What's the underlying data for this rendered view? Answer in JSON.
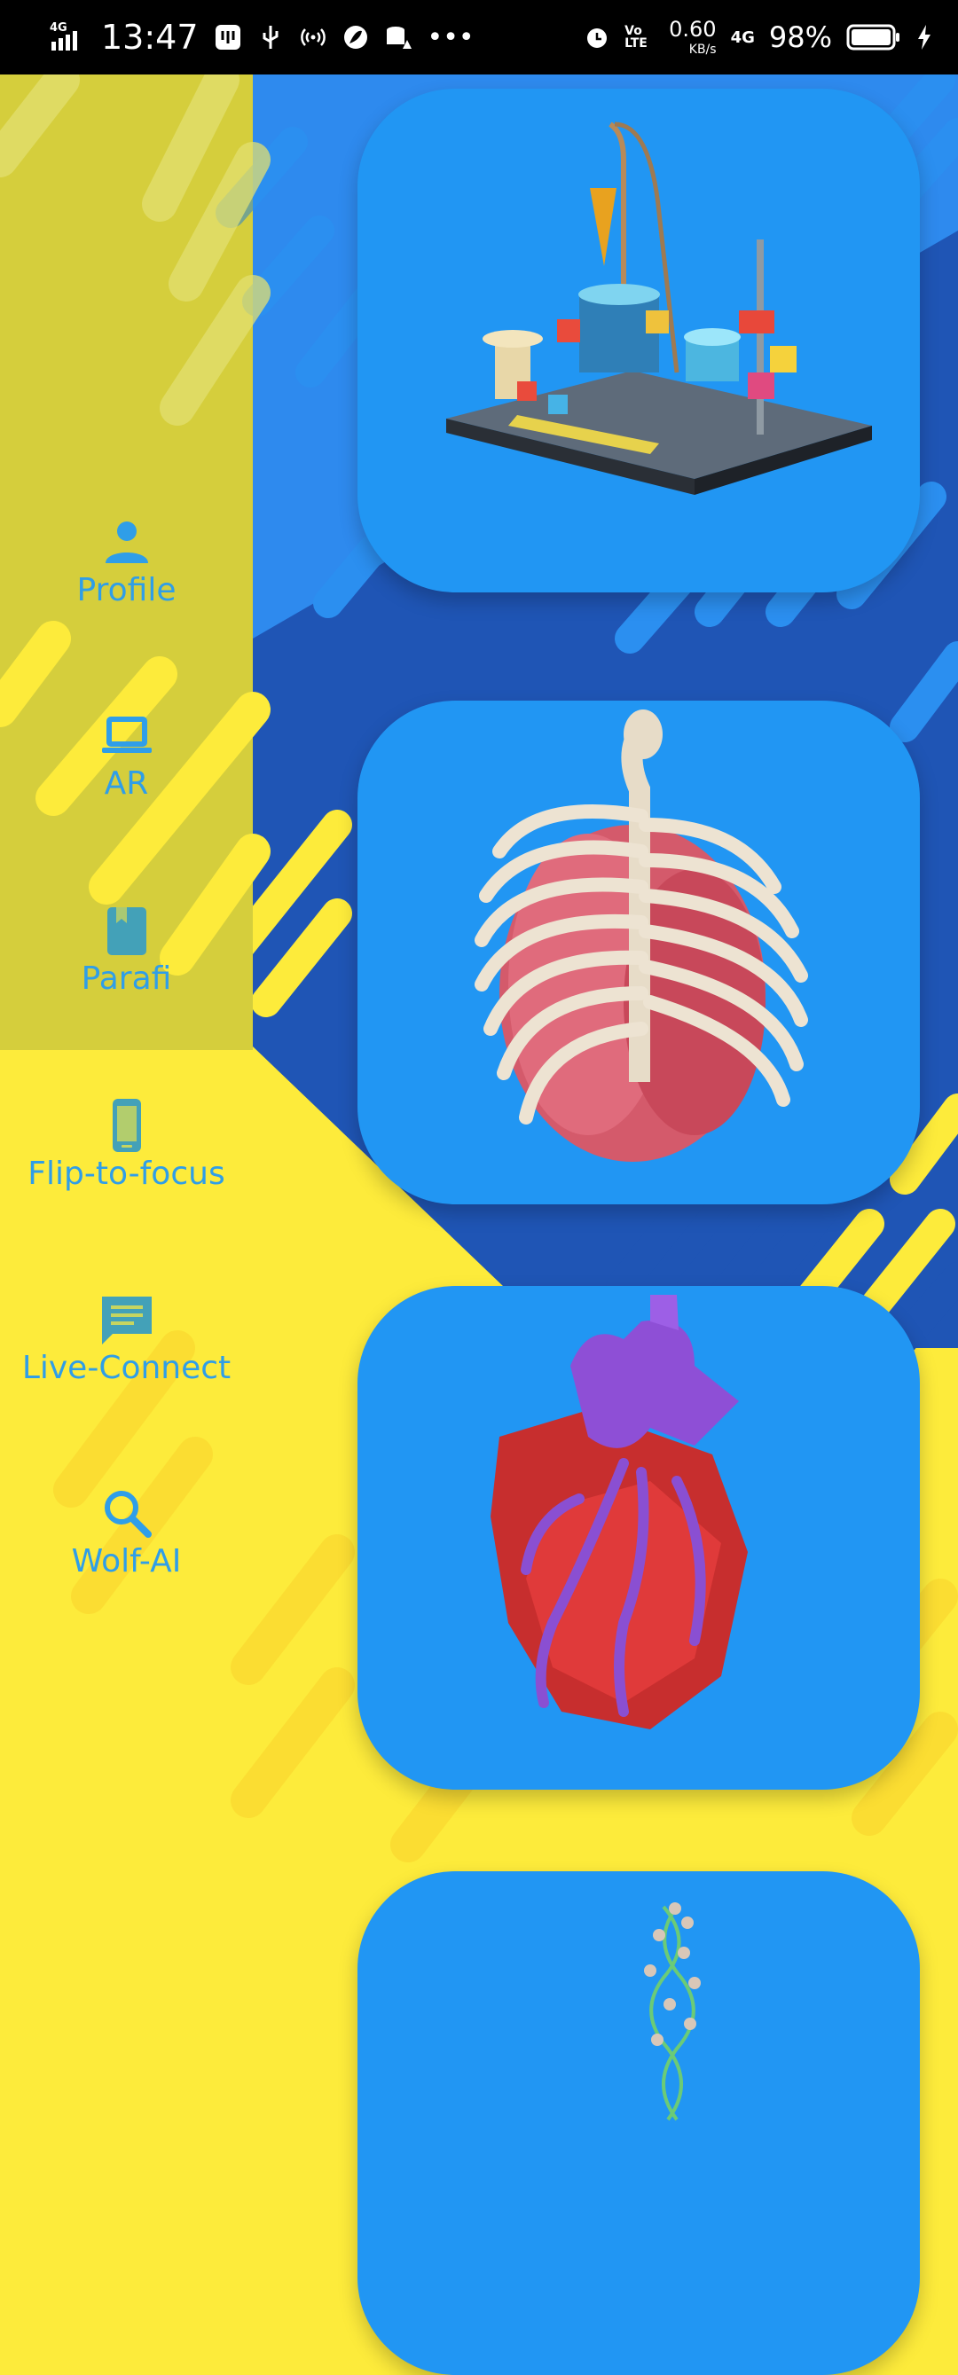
{
  "status_bar": {
    "network_left": "4G",
    "time": "13:47",
    "speed_value": "0.60",
    "speed_unit": "KB/s",
    "volte": "Vo LTE",
    "network_right": "4G",
    "battery_percent": "98%"
  },
  "sidebar": {
    "items": [
      {
        "label": "Profile",
        "icon": "person-icon"
      },
      {
        "label": "AR",
        "icon": "laptop-icon"
      },
      {
        "label": "Parafi",
        "icon": "book-icon"
      },
      {
        "label": "Flip-to-focus",
        "icon": "phone-icon"
      },
      {
        "label": "Live-Connect",
        "icon": "chat-icon"
      },
      {
        "label": "Wolf-AI",
        "icon": "search-icon"
      }
    ],
    "label_color": "#2F9EE8"
  },
  "cards": [
    {
      "subject": "chemistry-lab",
      "icon": "lab-equipment-icon"
    },
    {
      "subject": "lungs-ribcage",
      "icon": "ribcage-lungs-icon"
    },
    {
      "subject": "heart",
      "icon": "heart-model-icon"
    },
    {
      "subject": "dna",
      "icon": "dna-helix-icon"
    }
  ],
  "colors": {
    "yellow": "#FDEB3B",
    "blue": "#2196F3",
    "dark_blue": "#1F55B5",
    "sidebar_overlay": "#C8C850"
  }
}
